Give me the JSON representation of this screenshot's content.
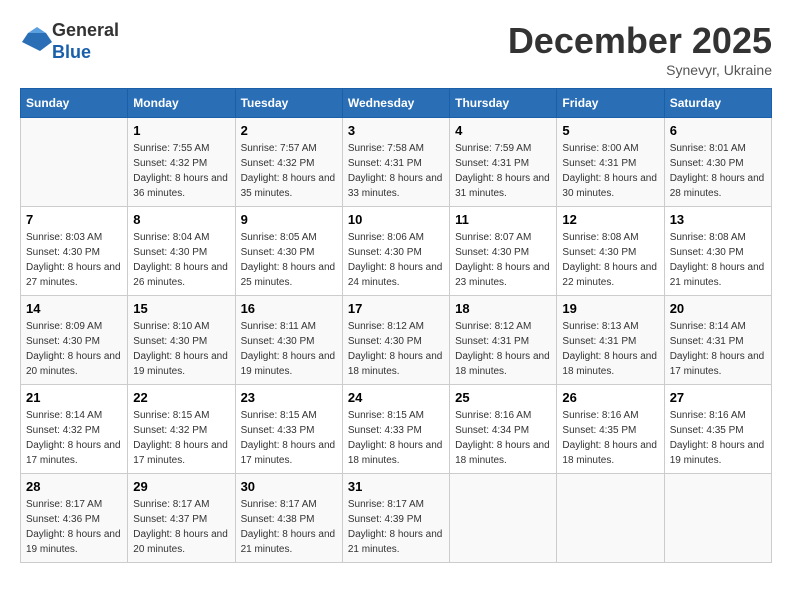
{
  "header": {
    "logo": {
      "line1": "General",
      "line2": "Blue"
    },
    "title": "December 2025",
    "subtitle": "Synevyr, Ukraine"
  },
  "days_of_week": [
    "Sunday",
    "Monday",
    "Tuesday",
    "Wednesday",
    "Thursday",
    "Friday",
    "Saturday"
  ],
  "weeks": [
    [
      {
        "day": "",
        "sunrise": "",
        "sunset": "",
        "daylight": ""
      },
      {
        "day": "1",
        "sunrise": "Sunrise: 7:55 AM",
        "sunset": "Sunset: 4:32 PM",
        "daylight": "Daylight: 8 hours and 36 minutes."
      },
      {
        "day": "2",
        "sunrise": "Sunrise: 7:57 AM",
        "sunset": "Sunset: 4:32 PM",
        "daylight": "Daylight: 8 hours and 35 minutes."
      },
      {
        "day": "3",
        "sunrise": "Sunrise: 7:58 AM",
        "sunset": "Sunset: 4:31 PM",
        "daylight": "Daylight: 8 hours and 33 minutes."
      },
      {
        "day": "4",
        "sunrise": "Sunrise: 7:59 AM",
        "sunset": "Sunset: 4:31 PM",
        "daylight": "Daylight: 8 hours and 31 minutes."
      },
      {
        "day": "5",
        "sunrise": "Sunrise: 8:00 AM",
        "sunset": "Sunset: 4:31 PM",
        "daylight": "Daylight: 8 hours and 30 minutes."
      },
      {
        "day": "6",
        "sunrise": "Sunrise: 8:01 AM",
        "sunset": "Sunset: 4:30 PM",
        "daylight": "Daylight: 8 hours and 28 minutes."
      }
    ],
    [
      {
        "day": "7",
        "sunrise": "Sunrise: 8:03 AM",
        "sunset": "Sunset: 4:30 PM",
        "daylight": "Daylight: 8 hours and 27 minutes."
      },
      {
        "day": "8",
        "sunrise": "Sunrise: 8:04 AM",
        "sunset": "Sunset: 4:30 PM",
        "daylight": "Daylight: 8 hours and 26 minutes."
      },
      {
        "day": "9",
        "sunrise": "Sunrise: 8:05 AM",
        "sunset": "Sunset: 4:30 PM",
        "daylight": "Daylight: 8 hours and 25 minutes."
      },
      {
        "day": "10",
        "sunrise": "Sunrise: 8:06 AM",
        "sunset": "Sunset: 4:30 PM",
        "daylight": "Daylight: 8 hours and 24 minutes."
      },
      {
        "day": "11",
        "sunrise": "Sunrise: 8:07 AM",
        "sunset": "Sunset: 4:30 PM",
        "daylight": "Daylight: 8 hours and 23 minutes."
      },
      {
        "day": "12",
        "sunrise": "Sunrise: 8:08 AM",
        "sunset": "Sunset: 4:30 PM",
        "daylight": "Daylight: 8 hours and 22 minutes."
      },
      {
        "day": "13",
        "sunrise": "Sunrise: 8:08 AM",
        "sunset": "Sunset: 4:30 PM",
        "daylight": "Daylight: 8 hours and 21 minutes."
      }
    ],
    [
      {
        "day": "14",
        "sunrise": "Sunrise: 8:09 AM",
        "sunset": "Sunset: 4:30 PM",
        "daylight": "Daylight: 8 hours and 20 minutes."
      },
      {
        "day": "15",
        "sunrise": "Sunrise: 8:10 AM",
        "sunset": "Sunset: 4:30 PM",
        "daylight": "Daylight: 8 hours and 19 minutes."
      },
      {
        "day": "16",
        "sunrise": "Sunrise: 8:11 AM",
        "sunset": "Sunset: 4:30 PM",
        "daylight": "Daylight: 8 hours and 19 minutes."
      },
      {
        "day": "17",
        "sunrise": "Sunrise: 8:12 AM",
        "sunset": "Sunset: 4:30 PM",
        "daylight": "Daylight: 8 hours and 18 minutes."
      },
      {
        "day": "18",
        "sunrise": "Sunrise: 8:12 AM",
        "sunset": "Sunset: 4:31 PM",
        "daylight": "Daylight: 8 hours and 18 minutes."
      },
      {
        "day": "19",
        "sunrise": "Sunrise: 8:13 AM",
        "sunset": "Sunset: 4:31 PM",
        "daylight": "Daylight: 8 hours and 18 minutes."
      },
      {
        "day": "20",
        "sunrise": "Sunrise: 8:14 AM",
        "sunset": "Sunset: 4:31 PM",
        "daylight": "Daylight: 8 hours and 17 minutes."
      }
    ],
    [
      {
        "day": "21",
        "sunrise": "Sunrise: 8:14 AM",
        "sunset": "Sunset: 4:32 PM",
        "daylight": "Daylight: 8 hours and 17 minutes."
      },
      {
        "day": "22",
        "sunrise": "Sunrise: 8:15 AM",
        "sunset": "Sunset: 4:32 PM",
        "daylight": "Daylight: 8 hours and 17 minutes."
      },
      {
        "day": "23",
        "sunrise": "Sunrise: 8:15 AM",
        "sunset": "Sunset: 4:33 PM",
        "daylight": "Daylight: 8 hours and 17 minutes."
      },
      {
        "day": "24",
        "sunrise": "Sunrise: 8:15 AM",
        "sunset": "Sunset: 4:33 PM",
        "daylight": "Daylight: 8 hours and 18 minutes."
      },
      {
        "day": "25",
        "sunrise": "Sunrise: 8:16 AM",
        "sunset": "Sunset: 4:34 PM",
        "daylight": "Daylight: 8 hours and 18 minutes."
      },
      {
        "day": "26",
        "sunrise": "Sunrise: 8:16 AM",
        "sunset": "Sunset: 4:35 PM",
        "daylight": "Daylight: 8 hours and 18 minutes."
      },
      {
        "day": "27",
        "sunrise": "Sunrise: 8:16 AM",
        "sunset": "Sunset: 4:35 PM",
        "daylight": "Daylight: 8 hours and 19 minutes."
      }
    ],
    [
      {
        "day": "28",
        "sunrise": "Sunrise: 8:17 AM",
        "sunset": "Sunset: 4:36 PM",
        "daylight": "Daylight: 8 hours and 19 minutes."
      },
      {
        "day": "29",
        "sunrise": "Sunrise: 8:17 AM",
        "sunset": "Sunset: 4:37 PM",
        "daylight": "Daylight: 8 hours and 20 minutes."
      },
      {
        "day": "30",
        "sunrise": "Sunrise: 8:17 AM",
        "sunset": "Sunset: 4:38 PM",
        "daylight": "Daylight: 8 hours and 21 minutes."
      },
      {
        "day": "31",
        "sunrise": "Sunrise: 8:17 AM",
        "sunset": "Sunset: 4:39 PM",
        "daylight": "Daylight: 8 hours and 21 minutes."
      },
      {
        "day": "",
        "sunrise": "",
        "sunset": "",
        "daylight": ""
      },
      {
        "day": "",
        "sunrise": "",
        "sunset": "",
        "daylight": ""
      },
      {
        "day": "",
        "sunrise": "",
        "sunset": "",
        "daylight": ""
      }
    ]
  ]
}
